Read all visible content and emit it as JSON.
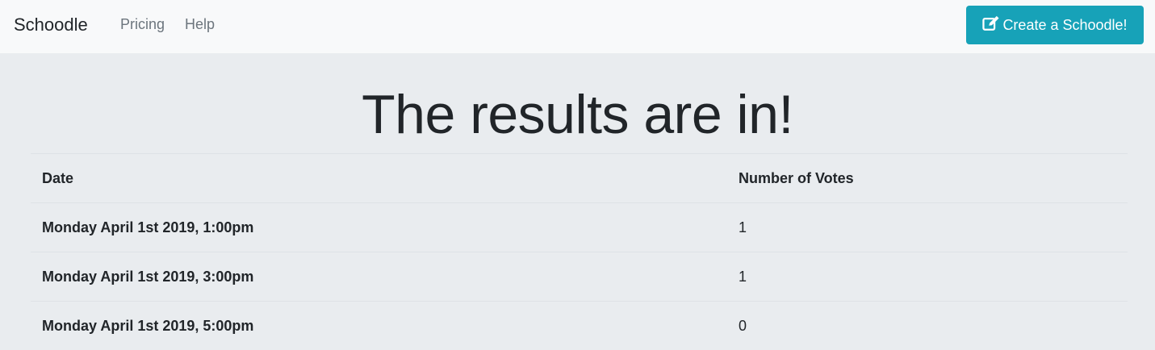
{
  "navbar": {
    "brand": "Schoodle",
    "links": [
      {
        "label": "Pricing"
      },
      {
        "label": "Help"
      }
    ],
    "create_button": {
      "label": "Create a Schoodle!",
      "icon": "edit-icon",
      "color": "#17a2b8"
    }
  },
  "main": {
    "title": "The results are in!",
    "table": {
      "headers": [
        "Date",
        "Number of Votes"
      ],
      "rows": [
        {
          "date": "Monday April 1st 2019, 1:00pm",
          "votes": "1"
        },
        {
          "date": "Monday April 1st 2019, 3:00pm",
          "votes": "1"
        },
        {
          "date": "Monday April 1st 2019, 5:00pm",
          "votes": "0"
        }
      ]
    }
  }
}
